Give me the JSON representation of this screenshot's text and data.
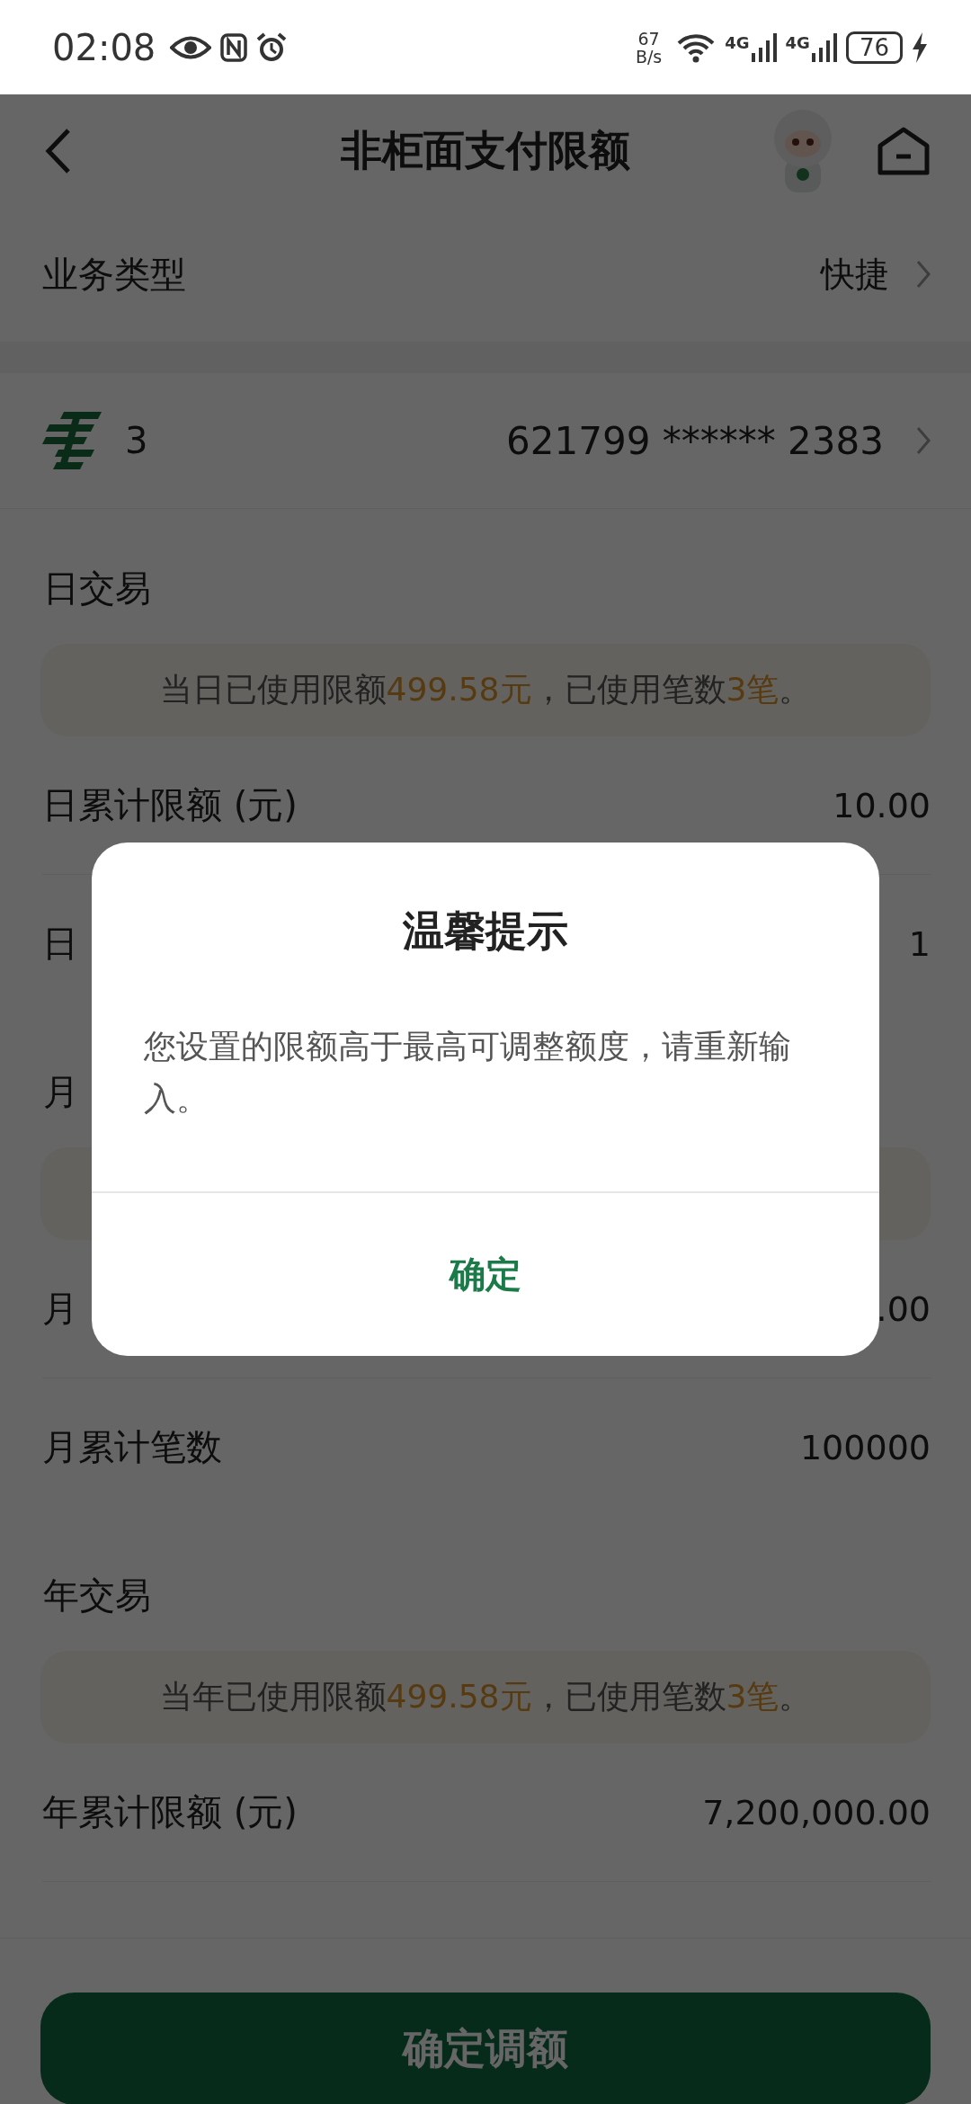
{
  "status_bar": {
    "time": "02:08",
    "net_speed": "67",
    "net_speed_unit": "B/s",
    "signals": [
      {
        "label": "4G"
      },
      {
        "label": "4G"
      }
    ],
    "battery": "76"
  },
  "header": {
    "title": "非柜面支付限额"
  },
  "business_type": {
    "label": "业务类型",
    "value": "快捷"
  },
  "card": {
    "name": "3",
    "number": "621799 ****** 2383"
  },
  "sections": [
    {
      "items": [
        {
          "kind": "title",
          "text": "日交易"
        },
        {
          "kind": "notice",
          "parts": [
            {
              "text": "当日已使用限额",
              "highlight": false
            },
            {
              "text": "499.58元",
              "highlight": true
            },
            {
              "text": "，已使用笔数",
              "highlight": false
            },
            {
              "text": "3笔",
              "highlight": true
            },
            {
              "text": "。",
              "highlight": false
            }
          ]
        },
        {
          "kind": "row",
          "label": "日累计限额 (元)",
          "value": "10.00"
        },
        {
          "kind": "row",
          "label": "日",
          "value": "1"
        }
      ]
    },
    {
      "items": [
        {
          "kind": "title",
          "text": "月"
        },
        {
          "kind": "notice"
        },
        {
          "kind": "row",
          "label": "月",
          "value": ".00"
        },
        {
          "kind": "row",
          "label": "月累计笔数",
          "value": "100000"
        }
      ]
    },
    {
      "items": [
        {
          "kind": "title",
          "text": "年交易"
        },
        {
          "kind": "notice",
          "parts": [
            {
              "text": "当年已使用限额",
              "highlight": false
            },
            {
              "text": "499.58元",
              "highlight": true
            },
            {
              "text": "，已使用笔数",
              "highlight": false
            },
            {
              "text": "3笔",
              "highlight": true
            },
            {
              "text": "。",
              "highlight": false
            }
          ]
        },
        {
          "kind": "row",
          "label": "年累计限额 (元)",
          "value": "7,200,000.00"
        }
      ]
    }
  ],
  "bottom_button": {
    "label": "确定调额"
  },
  "dialog": {
    "title": "温馨提示",
    "message": "您设置的限额高于最高可调整额度，请重新输入。",
    "button": "确定"
  }
}
